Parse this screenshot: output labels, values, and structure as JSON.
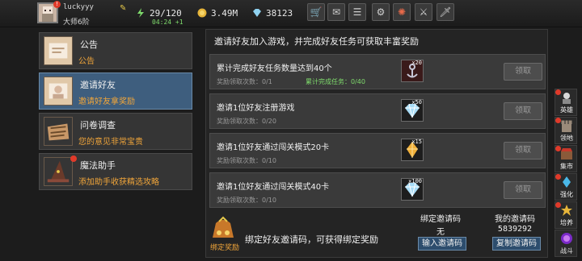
{
  "header": {
    "username": "luckyyy",
    "rank": "大师6阶",
    "energy": "29/120",
    "timer": "04:24 +1",
    "gold": "3.49M",
    "gems": "38123",
    "icons": [
      "cart-icon",
      "mail-icon",
      "chat-icon",
      "settings-icon",
      "wheel-icon",
      "equipment-icon",
      "sword-icon"
    ]
  },
  "sidebar": {
    "items": [
      {
        "title": "公告",
        "subtitle": "公告"
      },
      {
        "title": "邀请好友",
        "subtitle": "邀请好友拿奖励"
      },
      {
        "title": "问卷调查",
        "subtitle": "您的意见非常宝贵"
      },
      {
        "title": "魔法助手",
        "subtitle": "添加助手收获精选攻略"
      }
    ]
  },
  "main": {
    "banner": "邀请好友加入游戏，并完成好友任务可获取丰富奖励",
    "tasks": [
      {
        "title": "累计完成好友任务数量达到40个",
        "count": "奖励领取次数：0/1",
        "progress": "累计完成任务：0/40",
        "reward_qty": "x20",
        "claim": "领取"
      },
      {
        "title": "邀请1位好友注册游戏",
        "count": "奖励领取次数：0/20",
        "progress": "",
        "reward_qty": "x50",
        "claim": "领取"
      },
      {
        "title": "邀请1位好友通过闯关模式20卡",
        "count": "奖励领取次数：0/10",
        "progress": "",
        "reward_qty": "x15",
        "claim": "领取"
      },
      {
        "title": "邀请1位好友通过闯关模式40卡",
        "count": "奖励领取次数：0/10",
        "progress": "",
        "reward_qty": "x100",
        "claim": "领取"
      }
    ],
    "bind": {
      "label": "绑定奖励",
      "text": "绑定好友邀请码，可获得绑定奖励"
    },
    "bound_code": {
      "header": "绑定邀请码",
      "value": "无",
      "button": "输入邀请码"
    },
    "my_code": {
      "header": "我的邀请码",
      "value": "5839292",
      "button": "复制邀请码"
    }
  },
  "rightbar": {
    "items": [
      {
        "label": "英雄"
      },
      {
        "label": "领地"
      },
      {
        "label": "集市"
      },
      {
        "label": "强化"
      },
      {
        "label": "培养"
      },
      {
        "label": "战斗"
      }
    ]
  },
  "colors": {
    "active_tab": "#3e5e7e",
    "orange_text": "#f0a53a",
    "green_text": "#7fdc6c",
    "panel": "#3a3a3a"
  }
}
